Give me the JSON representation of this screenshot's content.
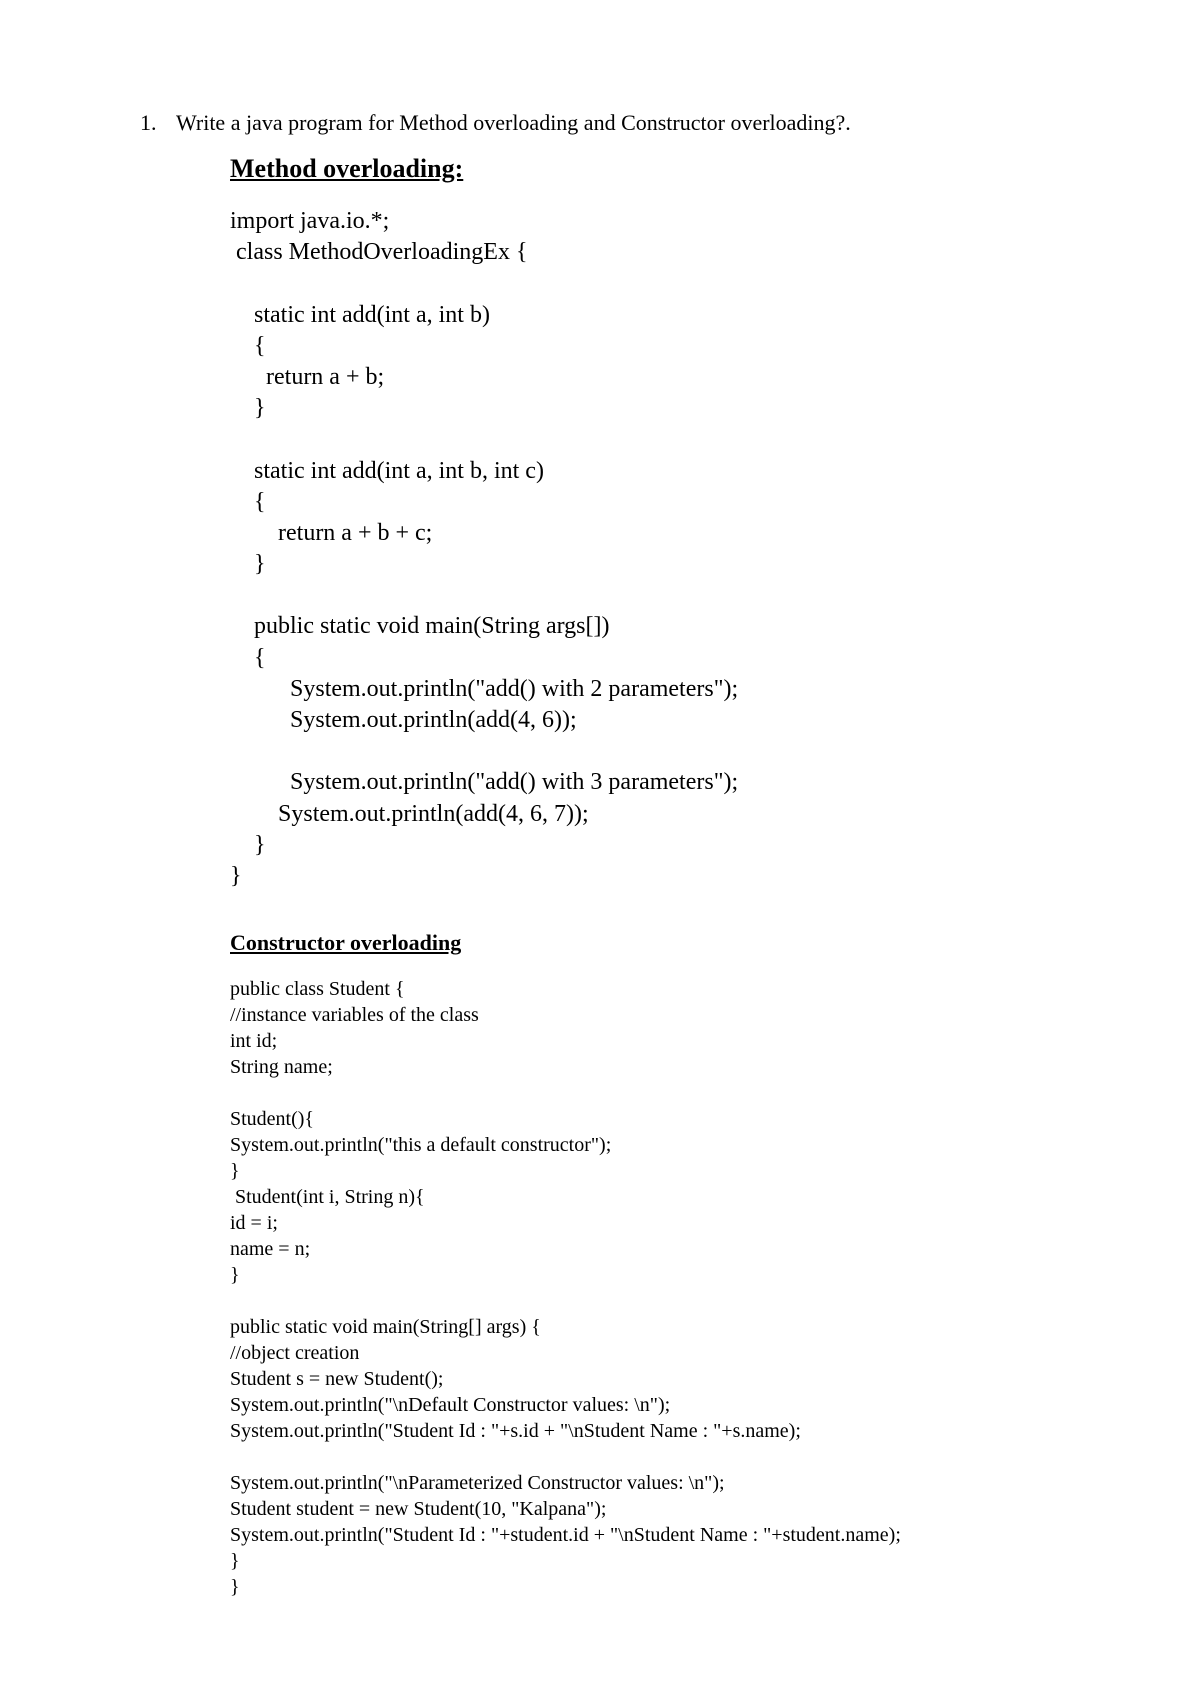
{
  "question": {
    "number": "1.",
    "text": "Write a java program for Method overloading and Constructor overloading?."
  },
  "section1": {
    "heading": "Method overloading:",
    "code": "import java.io.*;\n class MethodOverloadingEx {\n\n    static int add(int a, int b)\n    {\n      return a + b;\n    }\n\n    static int add(int a, int b, int c)\n    {\n        return a + b + c;\n    }\n\n    public static void main(String args[])\n    {\n          System.out.println(\"add() with 2 parameters\");\n          System.out.println(add(4, 6));\n\n          System.out.println(\"add() with 3 parameters\");\n        System.out.println(add(4, 6, 7));\n    }\n}"
  },
  "section2": {
    "heading": "Constructor overloading",
    "code": "public class Student {\n//instance variables of the class\nint id;\nString name;\n\nStudent(){\nSystem.out.println(\"this a default constructor\");\n}\n Student(int i, String n){\nid = i;\nname = n;\n}\n\npublic static void main(String[] args) {\n//object creation\nStudent s = new Student();\nSystem.out.println(\"\\nDefault Constructor values: \\n\");\nSystem.out.println(\"Student Id : \"+s.id + \"\\nStudent Name : \"+s.name);\n\nSystem.out.println(\"\\nParameterized Constructor values: \\n\");\nStudent student = new Student(10, \"Kalpana\");\nSystem.out.println(\"Student Id : \"+student.id + \"\\nStudent Name : \"+student.name);\n}\n}"
  }
}
